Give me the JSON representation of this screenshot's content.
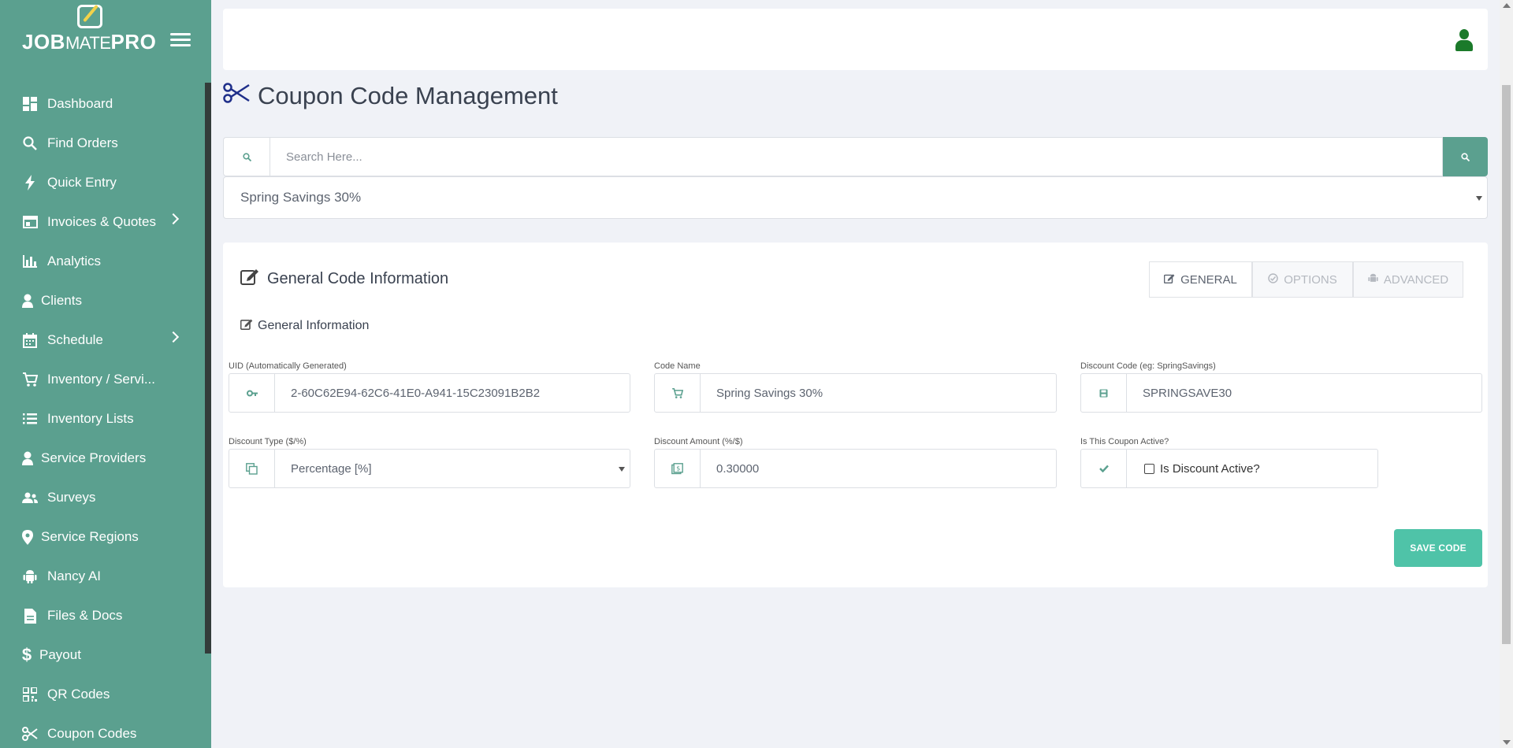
{
  "brand": {
    "name_bold": "JOB",
    "name_thin": "MATE",
    "name_bold2": "PRO"
  },
  "sidebar": {
    "items": [
      {
        "label": "Dashboard",
        "icon": "dashboard-icon",
        "chevron": false
      },
      {
        "label": "Find Orders",
        "icon": "search-icon",
        "chevron": false
      },
      {
        "label": "Quick Entry",
        "icon": "bolt-icon",
        "chevron": false
      },
      {
        "label": "Invoices & Quotes",
        "icon": "invoice-icon",
        "chevron": true
      },
      {
        "label": "Analytics",
        "icon": "bar-chart-icon",
        "chevron": false
      },
      {
        "label": "Clients",
        "icon": "user-icon",
        "chevron": false
      },
      {
        "label": "Schedule",
        "icon": "calendar-icon",
        "chevron": true
      },
      {
        "label": "Inventory / Servi...",
        "icon": "cart-icon",
        "chevron": false
      },
      {
        "label": "Inventory Lists",
        "icon": "list-icon",
        "chevron": false
      },
      {
        "label": "Service Providers",
        "icon": "user-icon",
        "chevron": false
      },
      {
        "label": "Surveys",
        "icon": "users-icon",
        "chevron": false
      },
      {
        "label": "Service Regions",
        "icon": "map-pin-icon",
        "chevron": false
      },
      {
        "label": "Nancy AI",
        "icon": "android-icon",
        "chevron": false
      },
      {
        "label": "Files & Docs",
        "icon": "file-icon",
        "chevron": false
      },
      {
        "label": "Payout",
        "icon": "dollar-icon",
        "chevron": false
      },
      {
        "label": "QR Codes",
        "icon": "qr-code-icon",
        "chevron": false
      },
      {
        "label": "Coupon Codes",
        "icon": "scissors-icon",
        "chevron": false
      }
    ]
  },
  "page": {
    "title": "Coupon Code Management"
  },
  "search": {
    "placeholder": "Search Here...",
    "value": ""
  },
  "code_select": {
    "selected": "Spring Savings 30%"
  },
  "card": {
    "title": "General Code Information",
    "section_title": "General Information",
    "tabs": [
      {
        "label": "GENERAL",
        "active": true
      },
      {
        "label": "OPTIONS",
        "active": false
      },
      {
        "label": "ADVANCED",
        "active": false
      }
    ],
    "fields": {
      "uid": {
        "label": "UID (Automatically Generated)",
        "value": "2-60C62E94-62C6-41E0-A941-15C23091B2B2"
      },
      "code_name": {
        "label": "Code Name",
        "value": "Spring Savings 30%"
      },
      "discount_code": {
        "label": "Discount Code (eg: SpringSavings)",
        "value": "SPRINGSAVE30"
      },
      "discount_type": {
        "label": "Discount Type ($/%)",
        "value": "Percentage [%]"
      },
      "discount_amount": {
        "label": "Discount Amount (%/$)",
        "value": "0.30000"
      },
      "active": {
        "label": "Is This Coupon Active?",
        "checkbox_label": "Is Discount Active?",
        "checked": false
      }
    },
    "save_label": "SAVE CODE"
  },
  "colors": {
    "sidebar": "#5ba08f",
    "accent": "#4fc3a8",
    "user": "#1b7a2a",
    "title_icon": "#1f2f8a"
  }
}
